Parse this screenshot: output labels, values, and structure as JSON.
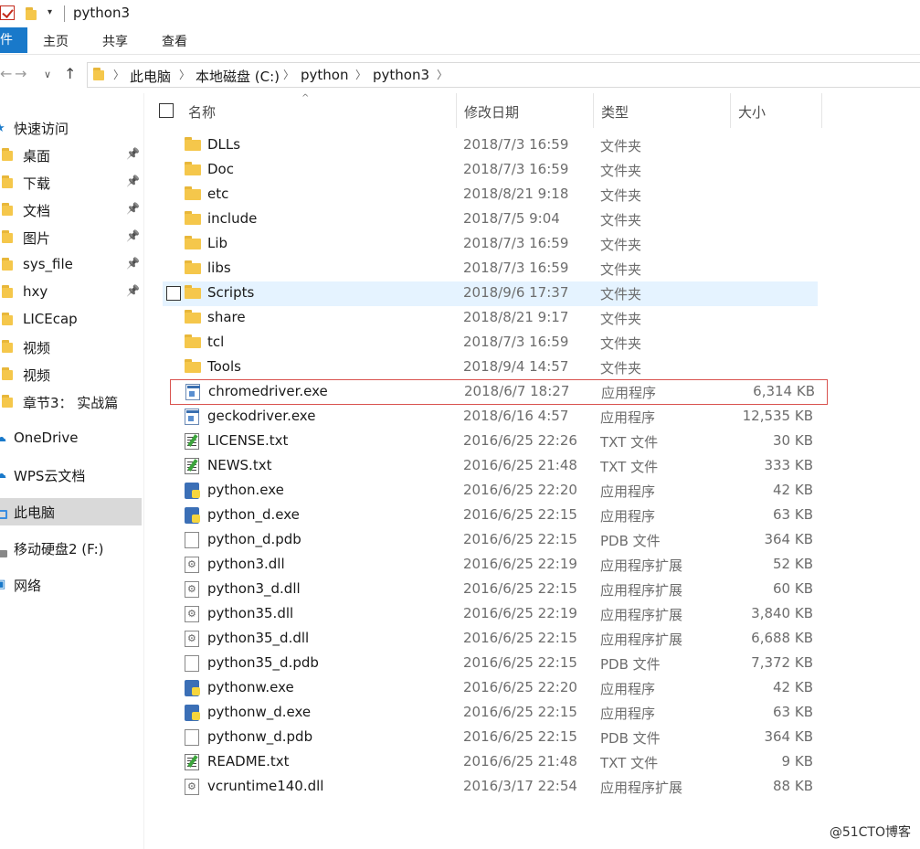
{
  "window": {
    "title": "python3"
  },
  "ribbon": {
    "file_tab": "件",
    "tabs": [
      "主页",
      "共享",
      "查看"
    ]
  },
  "address": {
    "crumbs": [
      "此电脑",
      "本地磁盘 (C:)",
      "python",
      "python3"
    ]
  },
  "sidebar": {
    "items": [
      {
        "label": "快速访问",
        "icon": "star-icon",
        "pinned": false,
        "root": true
      },
      {
        "label": "桌面",
        "icon": "desktop-folder-icon",
        "pinned": true
      },
      {
        "label": "下载",
        "icon": "download-folder-icon",
        "pinned": true
      },
      {
        "label": "文档",
        "icon": "documents-folder-icon",
        "pinned": true
      },
      {
        "label": "图片",
        "icon": "pictures-folder-icon",
        "pinned": true
      },
      {
        "label": "sys_file",
        "icon": "folder-icon",
        "pinned": true
      },
      {
        "label": "hxy",
        "icon": "folder-icon",
        "pinned": true
      },
      {
        "label": "LICEcap",
        "icon": "folder-icon",
        "pinned": false
      },
      {
        "label": "视频",
        "icon": "folder-icon",
        "pinned": false
      },
      {
        "label": "视频",
        "icon": "folder-icon",
        "pinned": false
      },
      {
        "label": "章节3：  实战篇",
        "icon": "folder-icon",
        "pinned": false
      },
      {
        "label": "OneDrive",
        "icon": "cloud-icon",
        "pinned": false,
        "root": true
      },
      {
        "label": "WPS云文档",
        "icon": "cloud-icon",
        "pinned": false,
        "root": true
      },
      {
        "label": "此电脑",
        "icon": "this-pc-icon",
        "pinned": false,
        "root": true,
        "selected": true
      },
      {
        "label": "移动硬盘2 (F:)",
        "icon": "drive-icon",
        "pinned": false,
        "root": true
      },
      {
        "label": "网络",
        "icon": "network-icon",
        "pinned": false,
        "root": true
      }
    ]
  },
  "columns": {
    "name": "名称",
    "date": "修改日期",
    "type": "类型",
    "size": "大小"
  },
  "files": [
    {
      "name": "DLLs",
      "date": "2018/7/3 16:59",
      "type": "文件夹",
      "size": "",
      "icon": "folder-icon"
    },
    {
      "name": "Doc",
      "date": "2018/7/3 16:59",
      "type": "文件夹",
      "size": "",
      "icon": "folder-icon"
    },
    {
      "name": "etc",
      "date": "2018/8/21 9:18",
      "type": "文件夹",
      "size": "",
      "icon": "folder-icon"
    },
    {
      "name": "include",
      "date": "2018/7/5 9:04",
      "type": "文件夹",
      "size": "",
      "icon": "folder-icon"
    },
    {
      "name": "Lib",
      "date": "2018/7/3 16:59",
      "type": "文件夹",
      "size": "",
      "icon": "folder-icon"
    },
    {
      "name": "libs",
      "date": "2018/7/3 16:59",
      "type": "文件夹",
      "size": "",
      "icon": "folder-icon"
    },
    {
      "name": "Scripts",
      "date": "2018/9/6 17:37",
      "type": "文件夹",
      "size": "",
      "icon": "folder-icon",
      "hover": true
    },
    {
      "name": "share",
      "date": "2018/8/21 9:17",
      "type": "文件夹",
      "size": "",
      "icon": "folder-icon"
    },
    {
      "name": "tcl",
      "date": "2018/7/3 16:59",
      "type": "文件夹",
      "size": "",
      "icon": "folder-icon"
    },
    {
      "name": "Tools",
      "date": "2018/9/4 14:57",
      "type": "文件夹",
      "size": "",
      "icon": "folder-icon"
    },
    {
      "name": "chromedriver.exe",
      "date": "2018/6/7 18:27",
      "type": "应用程序",
      "size": "6,314 KB",
      "icon": "exe-icon",
      "outlined": true
    },
    {
      "name": "geckodriver.exe",
      "date": "2018/6/16 4:57",
      "type": "应用程序",
      "size": "12,535 KB",
      "icon": "exe-icon"
    },
    {
      "name": "LICENSE.txt",
      "date": "2016/6/25 22:26",
      "type": "TXT 文件",
      "size": "30 KB",
      "icon": "txt-icon"
    },
    {
      "name": "NEWS.txt",
      "date": "2016/6/25 21:48",
      "type": "TXT 文件",
      "size": "333 KB",
      "icon": "txt-icon"
    },
    {
      "name": "python.exe",
      "date": "2016/6/25 22:20",
      "type": "应用程序",
      "size": "42 KB",
      "icon": "python-icon"
    },
    {
      "name": "python_d.exe",
      "date": "2016/6/25 22:15",
      "type": "应用程序",
      "size": "63 KB",
      "icon": "python-icon"
    },
    {
      "name": "python_d.pdb",
      "date": "2016/6/25 22:15",
      "type": "PDB 文件",
      "size": "364 KB",
      "icon": "document-icon"
    },
    {
      "name": "python3.dll",
      "date": "2016/6/25 22:19",
      "type": "应用程序扩展",
      "size": "52 KB",
      "icon": "dll-icon"
    },
    {
      "name": "python3_d.dll",
      "date": "2016/6/25 22:15",
      "type": "应用程序扩展",
      "size": "60 KB",
      "icon": "dll-icon"
    },
    {
      "name": "python35.dll",
      "date": "2016/6/25 22:19",
      "type": "应用程序扩展",
      "size": "3,840 KB",
      "icon": "dll-icon"
    },
    {
      "name": "python35_d.dll",
      "date": "2016/6/25 22:15",
      "type": "应用程序扩展",
      "size": "6,688 KB",
      "icon": "dll-icon"
    },
    {
      "name": "python35_d.pdb",
      "date": "2016/6/25 22:15",
      "type": "PDB 文件",
      "size": "7,372 KB",
      "icon": "document-icon"
    },
    {
      "name": "pythonw.exe",
      "date": "2016/6/25 22:20",
      "type": "应用程序",
      "size": "42 KB",
      "icon": "python-icon"
    },
    {
      "name": "pythonw_d.exe",
      "date": "2016/6/25 22:15",
      "type": "应用程序",
      "size": "63 KB",
      "icon": "python-icon"
    },
    {
      "name": "pythonw_d.pdb",
      "date": "2016/6/25 22:15",
      "type": "PDB 文件",
      "size": "364 KB",
      "icon": "document-icon"
    },
    {
      "name": "README.txt",
      "date": "2016/6/25 21:48",
      "type": "TXT 文件",
      "size": "9 KB",
      "icon": "txt-icon"
    },
    {
      "name": "vcruntime140.dll",
      "date": "2016/3/17 22:54",
      "type": "应用程序扩展",
      "size": "88 KB",
      "icon": "dll-icon"
    }
  ],
  "watermark": "@51CTO博客",
  "colors": {
    "accent": "#1979ca",
    "hover": "#e5f3ff",
    "outline": "#d9534f",
    "folder": "#f5c74b"
  }
}
